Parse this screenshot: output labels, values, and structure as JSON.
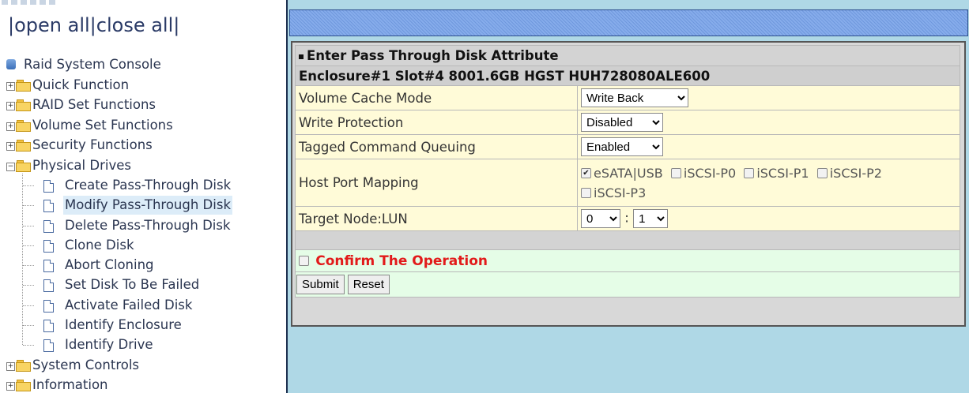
{
  "nav": {
    "open_all": "open all",
    "close_all": "close all",
    "separator": "|",
    "root": "Raid System Console",
    "folders": [
      {
        "label": "Quick Function"
      },
      {
        "label": "RAID Set Functions"
      },
      {
        "label": "Volume Set Functions"
      },
      {
        "label": "Security Functions"
      },
      {
        "label": "Physical Drives"
      }
    ],
    "physical_children": [
      "Create Pass-Through Disk",
      "Modify Pass-Through Disk",
      "Delete Pass-Through Disk",
      "Clone Disk",
      "Abort Cloning",
      "Set Disk To Be Failed",
      "Activate Failed Disk",
      "Identify Enclosure",
      "Identify Drive"
    ],
    "after_folders": [
      "System Controls",
      "Information"
    ],
    "selected": "Modify Pass-Through Disk"
  },
  "form": {
    "title": "Enter Pass Through Disk Attribute",
    "disk": "Enclosure#1 Slot#4 8001.6GB HGST HUH728080ALE600",
    "rows": {
      "cache_label": "Volume Cache Mode",
      "cache_value": "Write Back",
      "protect_label": "Write Protection",
      "protect_value": "Disabled",
      "tcq_label": "Tagged Command Queuing",
      "tcq_value": "Enabled",
      "hpm_label": "Host Port Mapping",
      "target_label": "Target Node:LUN",
      "target_node": "0",
      "target_sep": ":",
      "target_lun": "1"
    },
    "ports": [
      {
        "label": "eSATA|USB",
        "checked": true
      },
      {
        "label": "iSCSI-P0",
        "checked": false
      },
      {
        "label": "iSCSI-P1",
        "checked": false
      },
      {
        "label": "iSCSI-P2",
        "checked": false
      },
      {
        "label": "iSCSI-P3",
        "checked": false
      }
    ],
    "confirm": "Confirm The Operation",
    "submit": "Submit",
    "reset": "Reset"
  }
}
